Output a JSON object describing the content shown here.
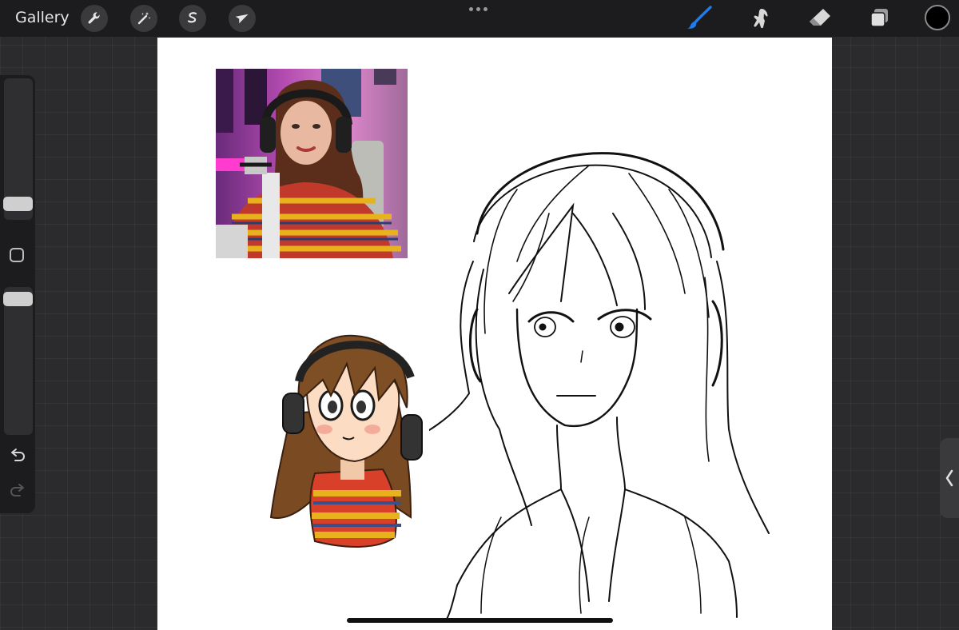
{
  "app": {
    "gallery_label": "Gallery"
  },
  "toolbar_left": [
    {
      "icon": "wrench-icon"
    },
    {
      "icon": "magic-wand-icon"
    },
    {
      "icon": "selection-icon"
    },
    {
      "icon": "transform-arrow-icon"
    }
  ],
  "toolbar_right": [
    {
      "icon": "brush-icon",
      "active": true
    },
    {
      "icon": "smudge-icon"
    },
    {
      "icon": "eraser-icon"
    },
    {
      "icon": "layers-icon"
    }
  ],
  "current_color": "#000000",
  "accent_color": "#1e7cf2",
  "sidebar": {
    "brush_size_level": 0.12,
    "opacity_level": 0.88,
    "controls": [
      "modify-icon",
      "undo-icon",
      "redo-icon"
    ]
  },
  "canvas": {
    "background": "#ffffff",
    "contents": [
      "reference-photo",
      "chibi-headphones-drawing",
      "sketch-girl-headphones"
    ]
  }
}
